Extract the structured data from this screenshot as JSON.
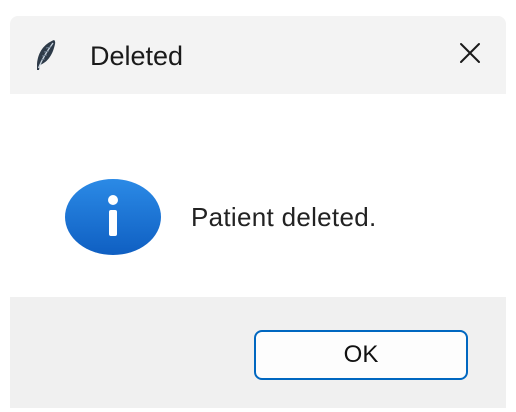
{
  "window": {
    "title": "Deleted",
    "title_icon": "feather-icon",
    "close_icon": "close-icon"
  },
  "dialog": {
    "message": "Patient deleted.",
    "message_icon": "info-icon",
    "ok_label": "OK"
  },
  "colors": {
    "titlebar_bg": "#f3f3f3",
    "footer_bg": "#f0f0f0",
    "info_blue": "#1b73d3",
    "button_border": "#0067c0"
  }
}
